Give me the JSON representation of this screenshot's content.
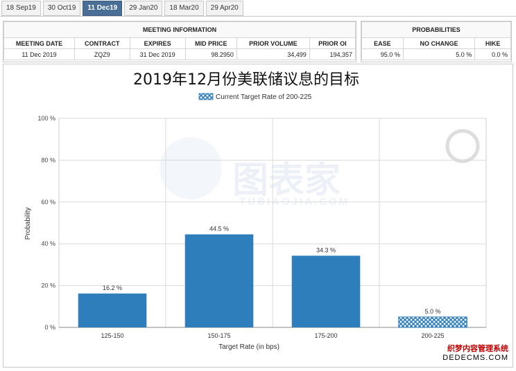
{
  "tabs": [
    {
      "label": "18 Sep19",
      "active": false
    },
    {
      "label": "30 Oct19",
      "active": false
    },
    {
      "label": "11 Dec19",
      "active": true
    },
    {
      "label": "29 Jan20",
      "active": false
    },
    {
      "label": "18 Mar20",
      "active": false
    },
    {
      "label": "29 Apr20",
      "active": false
    }
  ],
  "meeting": {
    "title": "MEETING INFORMATION",
    "columns": [
      "MEETING DATE",
      "CONTRACT",
      "EXPIRES",
      "MID PRICE",
      "PRIOR VOLUME",
      "PRIOR OI"
    ],
    "values": [
      "11 Dec 2019",
      "ZQZ9",
      "31 Dec 2019",
      "98.2950",
      "34,499",
      "194,357"
    ]
  },
  "probabilities": {
    "title": "PROBABILITIES",
    "columns": [
      "EASE",
      "NO CHANGE",
      "HIKE"
    ],
    "values": [
      "95.0 %",
      "5.0 %",
      "0.0 %"
    ]
  },
  "watermark": {
    "cn": "图表家",
    "en": "TUBIAOJIA.COM"
  },
  "corner": {
    "line1": "织梦内容管理系统",
    "line2": "DEDECMS.COM"
  },
  "colors": {
    "bar": "#2e7ebb",
    "current": "#2e7ebb",
    "tab_active": "#4a6f96"
  },
  "chart_data": {
    "type": "bar",
    "title": "2019年12月份美联储议息的目标",
    "xlabel": "Target Rate (in bps)",
    "ylabel": "Probability",
    "legend": {
      "label": "Current Target Rate of 200-225",
      "position": "top-center"
    },
    "ylim": [
      0,
      100
    ],
    "yticks": [
      0,
      20,
      40,
      60,
      80,
      100
    ],
    "ytick_labels": [
      "0 %",
      "20 %",
      "40 %",
      "60 %",
      "80 %",
      "100 %"
    ],
    "categories": [
      "125-150",
      "150-175",
      "175-200",
      "200-225"
    ],
    "values": [
      16.2,
      44.5,
      34.3,
      5.0
    ],
    "value_labels": [
      "16.2 %",
      "44.5 %",
      "34.3 %",
      "5.0 %"
    ],
    "current_category": "200-225",
    "grid": true
  }
}
